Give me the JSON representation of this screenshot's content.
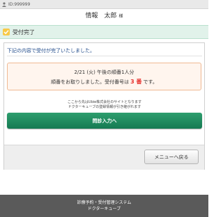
{
  "header": {
    "id_text": "ID:999999",
    "user_name": "情報　太郎",
    "honorific": "様"
  },
  "titlebar": {
    "title": "受付完了"
  },
  "main": {
    "lead_text": "下記の内容で受付が完了いたしました。",
    "info_line1": "2/21 (火) 午後の順番1人分",
    "info_line2_prefix": "順番をお取りしました。受付番号は",
    "reception_number": "3 番",
    "info_line2_suffix": "です。",
    "note_line1": "ここから先はUbie株式会社のサイトとなります",
    "note_line2": "ドクターキューブの登録情報が引き継がれます",
    "go_button_label": "問診入力へ",
    "menu_button_label": "メニューへ戻る"
  },
  "footer": {
    "line1": "診療予約・受付管理システム",
    "line2": "ドクターキューブ"
  },
  "colors": {
    "accent_green": "#1a8a5c",
    "reception_number": "#e6322f",
    "footer_bg": "#5a5a5a"
  },
  "icons": [
    "user-id-icon",
    "check-icon"
  ]
}
